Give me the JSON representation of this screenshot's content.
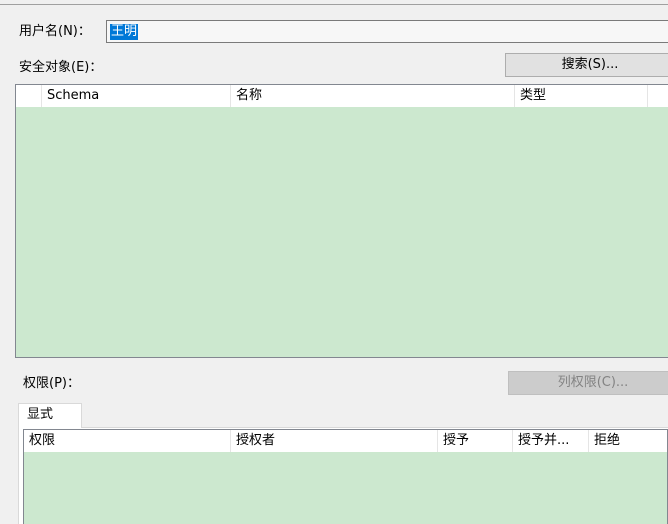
{
  "username": {
    "label": "用户名(N)：",
    "value": "王明"
  },
  "securables": {
    "label": "安全对象(E)：",
    "search_button": "搜索(S)...",
    "columns": [
      "",
      "Schema",
      "名称",
      "类型"
    ],
    "rows": []
  },
  "permissions": {
    "label": "权限(P)：",
    "column_permissions_button": "列权限(C)...",
    "tabs": [
      {
        "label": "显式"
      }
    ],
    "columns": [
      "权限",
      "授权者",
      "授予",
      "授予并...",
      "拒绝"
    ],
    "rows": []
  },
  "colors": {
    "grid_background": "#cce8cf",
    "selection": "#0078d7"
  }
}
